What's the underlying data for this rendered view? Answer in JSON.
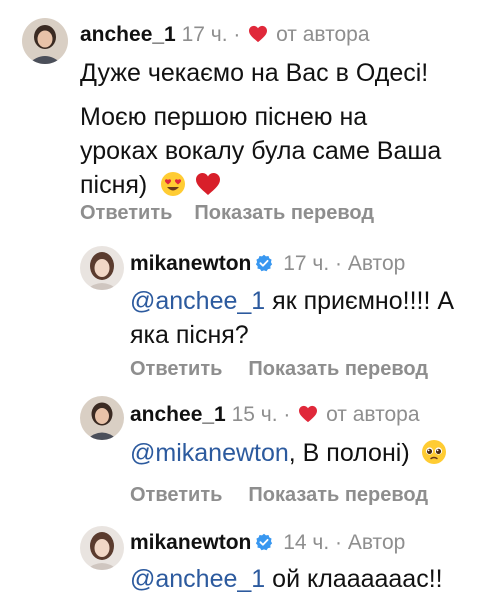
{
  "comments": [
    {
      "username": "anchee_1",
      "time": "17 ч.",
      "dot": "·",
      "badge": "от автора",
      "lines": [
        "Дуже чекаємо на Вас в Одесі!",
        "Моєю першою піснею на",
        "уроках вокалу була саме Ваша",
        "пісня)"
      ],
      "reply_label": "Ответить",
      "translate_label": "Показать перевод"
    },
    {
      "username": "mikanewton",
      "time": "17 ч.",
      "dot": "·",
      "badge": "Автор",
      "mention": "@anchee_1",
      "text_line1": " як приємно!!!! А",
      "text_line2": "яка пісня?",
      "reply_label": "Ответить",
      "translate_label": "Показать перевод"
    },
    {
      "username": "anchee_1",
      "time": "15 ч.",
      "dot": "·",
      "badge": "от автора",
      "mention": "@mikanewton",
      "text": ", В полоні)",
      "reply_label": "Ответить",
      "translate_label": "Показать перевод"
    },
    {
      "username": "mikanewton",
      "time": "14 ч.",
      "dot": "·",
      "badge": "Автор",
      "mention": "@anchee_1",
      "text": " ой клаааааас!!"
    }
  ],
  "colors": {
    "mention": "#2c5a9e",
    "heart": "#e0283a",
    "verified": "#3897f0",
    "meta": "#8e8e8e"
  },
  "icons": {
    "author_heart": "red-heart-icon",
    "verified": "verified-badge-icon",
    "emoji_1": "heart-eyes-emoji",
    "emoji_2": "red-heart-emoji",
    "emoji_3": "pleading-face-emoji"
  }
}
